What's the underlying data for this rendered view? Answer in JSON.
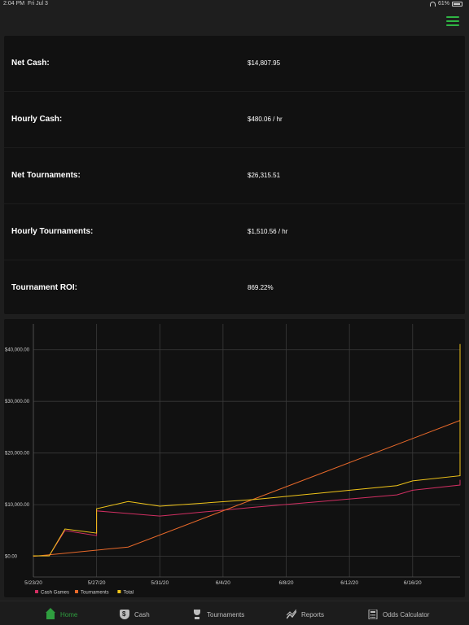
{
  "status_bar": {
    "time": "2:04 PM",
    "date": "Fri Jul 3",
    "battery": "61%"
  },
  "stats": [
    {
      "label": "Net Cash:",
      "value": "$14,807.95"
    },
    {
      "label": "Hourly Cash:",
      "value": "$480.06 / hr"
    },
    {
      "label": "Net Tournaments:",
      "value": "$26,315.51"
    },
    {
      "label": "Hourly Tournaments:",
      "value": "$1,510.56 / hr"
    },
    {
      "label": "Tournament ROI:",
      "value": "869.22%"
    }
  ],
  "tabs": [
    {
      "label": "Home",
      "icon": "home-icon",
      "active": true
    },
    {
      "label": "Cash",
      "icon": "cash-icon"
    },
    {
      "label": "Tournaments",
      "icon": "trophy-icon"
    },
    {
      "label": "Reports",
      "icon": "reports-icon"
    },
    {
      "label": "Odds Calculator",
      "icon": "calculator-icon"
    }
  ],
  "colors": {
    "accent": "#2f9e3f",
    "cash": "#d12f62",
    "tournaments": "#e8692a",
    "total": "#f0c419"
  },
  "chart_data": {
    "type": "line",
    "xlabel": "",
    "ylabel": "",
    "x_ticks": [
      "5/23/20",
      "5/27/20",
      "5/31/20",
      "6/4/20",
      "6/8/20",
      "6/12/20",
      "6/16/20"
    ],
    "y_ticks": [
      "$0.00",
      "$10,000.00",
      "$20,000.00",
      "$30,000.00",
      "$40,000.00"
    ],
    "xlim": [
      "2020-05-23",
      "2020-06-19"
    ],
    "ylim": [
      -4000,
      45000
    ],
    "grid": true,
    "legend_position": "bottom-left",
    "series": [
      {
        "name": "Cash Games",
        "color": "#d12f62",
        "points": [
          [
            "2020-05-23",
            0
          ],
          [
            "2020-05-23",
            100
          ],
          [
            "2020-05-24",
            100
          ],
          [
            "2020-05-25",
            5000
          ],
          [
            "2020-05-27",
            4000
          ],
          [
            "2020-05-27",
            8800
          ],
          [
            "2020-05-31",
            7800
          ],
          [
            "2020-06-06",
            9500
          ],
          [
            "2020-06-15",
            11900
          ],
          [
            "2020-06-16",
            12800
          ],
          [
            "2020-06-19",
            13800
          ],
          [
            "2020-06-19",
            14808
          ]
        ]
      },
      {
        "name": "Tournaments",
        "color": "#e8692a",
        "points": [
          [
            "2020-05-23",
            0
          ],
          [
            "2020-05-29",
            1800
          ],
          [
            "2020-06-19",
            26316
          ]
        ]
      },
      {
        "name": "Total",
        "color": "#f0c419",
        "points": [
          [
            "2020-05-23",
            0
          ],
          [
            "2020-05-23",
            100
          ],
          [
            "2020-05-24",
            100
          ],
          [
            "2020-05-25",
            5300
          ],
          [
            "2020-05-27",
            4500
          ],
          [
            "2020-05-27",
            9200
          ],
          [
            "2020-05-29",
            10600
          ],
          [
            "2020-05-31",
            9700
          ],
          [
            "2020-06-06",
            11000
          ],
          [
            "2020-06-15",
            13700
          ],
          [
            "2020-06-16",
            14600
          ],
          [
            "2020-06-19",
            15600
          ],
          [
            "2020-06-19",
            41100
          ]
        ]
      }
    ]
  }
}
